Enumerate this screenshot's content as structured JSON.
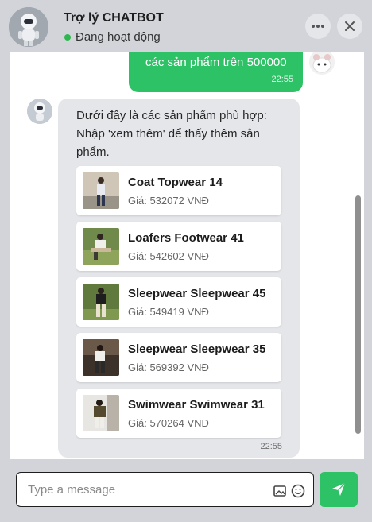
{
  "header": {
    "title": "Trợ lý CHATBOT",
    "status": "Đang hoạt động",
    "status_color": "#2db84d"
  },
  "icons": {
    "more": "more-horizontal-icon",
    "close": "close-icon",
    "image": "image-icon",
    "emoji": "emoji-icon",
    "send": "send-icon"
  },
  "messages": {
    "user": {
      "text": "các sản phẩm trên 500000",
      "time": "22:55"
    },
    "bot": {
      "text": "Dưới đây là các sản phẩm phù hợp: Nhập 'xem thêm' để thấy thêm sản phẩm.",
      "time": "22:55",
      "products": [
        {
          "name": "Coat Topwear 14",
          "price": "Giá: 532072 VNĐ"
        },
        {
          "name": "Loafers Footwear 41",
          "price": "Giá: 542602 VNĐ"
        },
        {
          "name": "Sleepwear Sleepwear 45",
          "price": "Giá: 549419 VNĐ"
        },
        {
          "name": "Sleepwear Sleepwear 35",
          "price": "Giá: 569392 VNĐ"
        },
        {
          "name": "Swimwear Swimwear 31",
          "price": "Giá: 570264 VNĐ"
        }
      ]
    }
  },
  "composer": {
    "placeholder": "Type a message"
  },
  "colors": {
    "accent": "#2ec267",
    "bot_bubble": "#e4e6ea",
    "background": "#d2d4da"
  }
}
